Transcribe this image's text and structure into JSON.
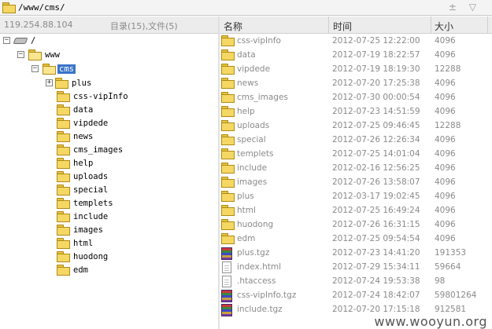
{
  "path_bar": {
    "path": "/www/cms/",
    "controls": "± ▽"
  },
  "info_bar": {
    "ip": "119.254.88.104",
    "counts": "目录(15),文件(5)"
  },
  "list_header": {
    "name": "名称",
    "time": "时间",
    "size": "大小"
  },
  "tree": {
    "root": "/",
    "www": "www",
    "cms": "cms",
    "children": [
      "plus",
      "css-vipInfo",
      "data",
      "vipdede",
      "news",
      "cms_images",
      "help",
      "uploads",
      "special",
      "templets",
      "include",
      "images",
      "html",
      "huodong",
      "edm"
    ]
  },
  "files": [
    {
      "icon": "folder",
      "name": "css-vipInfo",
      "time": "2012-07-25 12:22:00",
      "size": "4096"
    },
    {
      "icon": "folder",
      "name": "data",
      "time": "2012-07-19 18:22:57",
      "size": "4096"
    },
    {
      "icon": "folder",
      "name": "vipdede",
      "time": "2012-07-19 18:19:30",
      "size": "12288"
    },
    {
      "icon": "folder",
      "name": "news",
      "time": "2012-07-20 17:25:38",
      "size": "4096"
    },
    {
      "icon": "folder",
      "name": "cms_images",
      "time": "2012-07-30 00:00:54",
      "size": "4096"
    },
    {
      "icon": "folder",
      "name": "help",
      "time": "2012-07-23 14:51:59",
      "size": "4096"
    },
    {
      "icon": "folder",
      "name": "uploads",
      "time": "2012-07-25 09:46:45",
      "size": "12288"
    },
    {
      "icon": "folder",
      "name": "special",
      "time": "2012-07-26 12:26:34",
      "size": "4096"
    },
    {
      "icon": "folder",
      "name": "templets",
      "time": "2012-07-25 14:01:04",
      "size": "4096"
    },
    {
      "icon": "folder",
      "name": "include",
      "time": "2012-02-16 12:56:25",
      "size": "4096"
    },
    {
      "icon": "folder",
      "name": "images",
      "time": "2012-07-26 13:58:07",
      "size": "4096"
    },
    {
      "icon": "folder",
      "name": "plus",
      "time": "2012-03-17 19:02:45",
      "size": "4096"
    },
    {
      "icon": "folder",
      "name": "html",
      "time": "2012-07-25 16:49:24",
      "size": "4096"
    },
    {
      "icon": "folder",
      "name": "huodong",
      "time": "2012-07-26 16:31:15",
      "size": "4096"
    },
    {
      "icon": "folder",
      "name": "edm",
      "time": "2012-07-25 09:54:54",
      "size": "4096"
    },
    {
      "icon": "archive",
      "name": "plus.tgz",
      "time": "2012-07-23 14:41:20",
      "size": "191353"
    },
    {
      "icon": "document",
      "name": "index.html",
      "time": "2012-07-29 15:34:11",
      "size": "59664"
    },
    {
      "icon": "document",
      "name": ".htaccess",
      "time": "2012-07-24 19:53:38",
      "size": "98"
    },
    {
      "icon": "archive",
      "name": "css-vipInfo.tgz",
      "time": "2012-07-24 18:42:07",
      "size": "59801264"
    },
    {
      "icon": "archive",
      "name": "include.tgz",
      "time": "2012-07-20 17:15:18",
      "size": "912581"
    }
  ],
  "watermark": "www.wooyun.org"
}
